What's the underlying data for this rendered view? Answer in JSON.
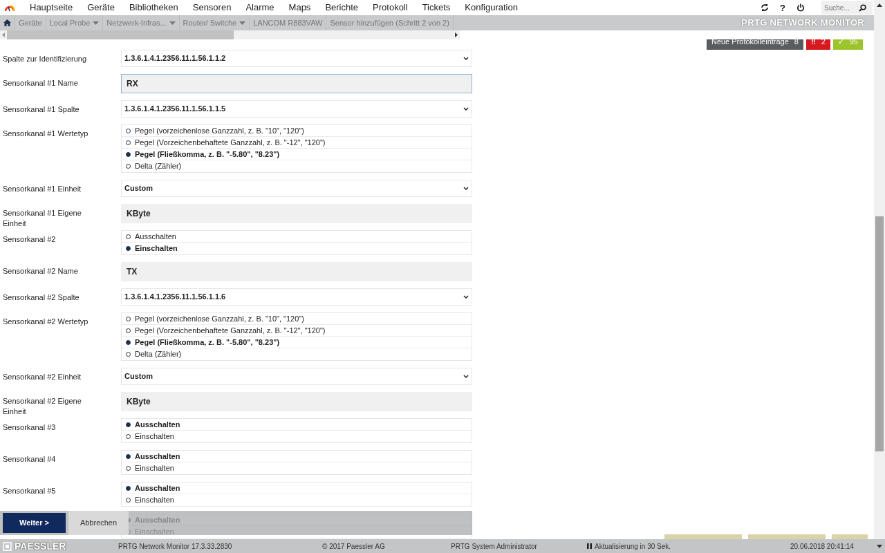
{
  "nav": {
    "items": [
      "Hauptseite",
      "Geräte",
      "Bibliotheken",
      "Sensoren",
      "Alarme",
      "Maps",
      "Berichte",
      "Protokoll",
      "Tickets",
      "Konfiguration"
    ],
    "help": "?",
    "search": {
      "placeholder": "Suche..."
    }
  },
  "breadcrumbs": [
    {
      "label": "Geräte",
      "dropdown": false
    },
    {
      "label": "Local Probe",
      "dropdown": true
    },
    {
      "label": "Netzwerk-Infras...",
      "dropdown": true
    },
    {
      "label": "Router/ Switche",
      "dropdown": true
    },
    {
      "label": "LANCOM R883VAW",
      "dropdown": false
    },
    {
      "label": "Sensor hinzufügen (Schritt 2 von 2)",
      "dropdown": false
    }
  ],
  "brand": "PRTG NETWORK MONITOR",
  "alerts": {
    "log": {
      "label": "Neue Protokolleinträge",
      "count": "8"
    },
    "errors": {
      "icon": "‼",
      "count": "2"
    },
    "ok": {
      "icon": "✓",
      "count": "95"
    }
  },
  "form": {
    "fields": [
      {
        "kind": "select",
        "label": "Spalte zur Identifizierung",
        "value": "1.3.6.1.4.1.2356.11.1.56.1.1.2"
      },
      {
        "kind": "text",
        "label": "Sensorkanal #1 Name",
        "value": "RX",
        "focused": true
      },
      {
        "kind": "select",
        "label": "Sensorkanal #1 Spalte",
        "value": "1.3.6.1.4.1.2356.11.1.56.1.1.5"
      },
      {
        "kind": "radio",
        "label": "Sensorkanal #1 Wertetyp",
        "options": [
          {
            "label": "Pegel (vorzeichenlose Ganzzahl, z. B. \"10\", \"120\")",
            "selected": false
          },
          {
            "label": "Pegel (Vorzeichenbehaftete Ganzzahl, z. B. \"-12\", \"120\")",
            "selected": false
          },
          {
            "label": "Pegel (Fließkomma, z. B. \"-5.80\", \"8.23\")",
            "selected": true
          },
          {
            "label": "Delta (Zähler)",
            "selected": false
          }
        ]
      },
      {
        "kind": "select",
        "label": "Sensorkanal #1 Einheit",
        "value": "Custom"
      },
      {
        "kind": "text",
        "label": "Sensorkanal #1 Eigene Einheit",
        "value": "KByte",
        "focused": false
      },
      {
        "kind": "radio",
        "label": "Sensorkanal #2",
        "options": [
          {
            "label": "Ausschalten",
            "selected": false
          },
          {
            "label": "Einschalten",
            "selected": true
          }
        ]
      },
      {
        "kind": "text",
        "label": "Sensorkanal #2 Name",
        "value": "TX",
        "focused": false
      },
      {
        "kind": "select",
        "label": "Sensorkanal #2 Spalte",
        "value": "1.3.6.1.4.1.2356.11.1.56.1.1.6"
      },
      {
        "kind": "radio",
        "label": "Sensorkanal #2 Wertetyp",
        "options": [
          {
            "label": "Pegel (vorzeichenlose Ganzzahl, z. B. \"10\", \"120\")",
            "selected": false
          },
          {
            "label": "Pegel (Vorzeichenbehaftete Ganzzahl, z. B. \"-12\", \"120\")",
            "selected": false
          },
          {
            "label": "Pegel (Fließkomma, z. B. \"-5.80\", \"8.23\")",
            "selected": true
          },
          {
            "label": "Delta (Zähler)",
            "selected": false
          }
        ]
      },
      {
        "kind": "select",
        "label": "Sensorkanal #2 Einheit",
        "value": "Custom"
      },
      {
        "kind": "text",
        "label": "Sensorkanal #2 Eigene Einheit",
        "value": "KByte",
        "focused": false
      },
      {
        "kind": "radio",
        "label": "Sensorkanal #3",
        "options": [
          {
            "label": "Ausschalten",
            "selected": true
          },
          {
            "label": "Einschalten",
            "selected": false
          }
        ]
      },
      {
        "kind": "radio",
        "label": "Sensorkanal #4",
        "options": [
          {
            "label": "Ausschalten",
            "selected": true
          },
          {
            "label": "Einschalten",
            "selected": false
          }
        ]
      },
      {
        "kind": "radio",
        "label": "Sensorkanal #5",
        "options": [
          {
            "label": "Ausschalten",
            "selected": true
          },
          {
            "label": "Einschalten",
            "selected": false
          }
        ]
      },
      {
        "kind": "radio",
        "options": [
          {
            "label": "Ausschalten",
            "selected": true
          },
          {
            "label": "Einschalten",
            "selected": false
          }
        ]
      }
    ]
  },
  "actions": {
    "next": "Weiter >",
    "cancel": "Abbrechen"
  },
  "footer": {
    "logo": "PAESSLER",
    "version": "PRTG Network Monitor 17.3.33.2830",
    "copyright": "© 2017 Paessler AG",
    "user": "PRTG System Administrator",
    "refresh": "Aktualisierung in 30 Sek.",
    "datetime": "20.06.2018 20:41:14"
  }
}
